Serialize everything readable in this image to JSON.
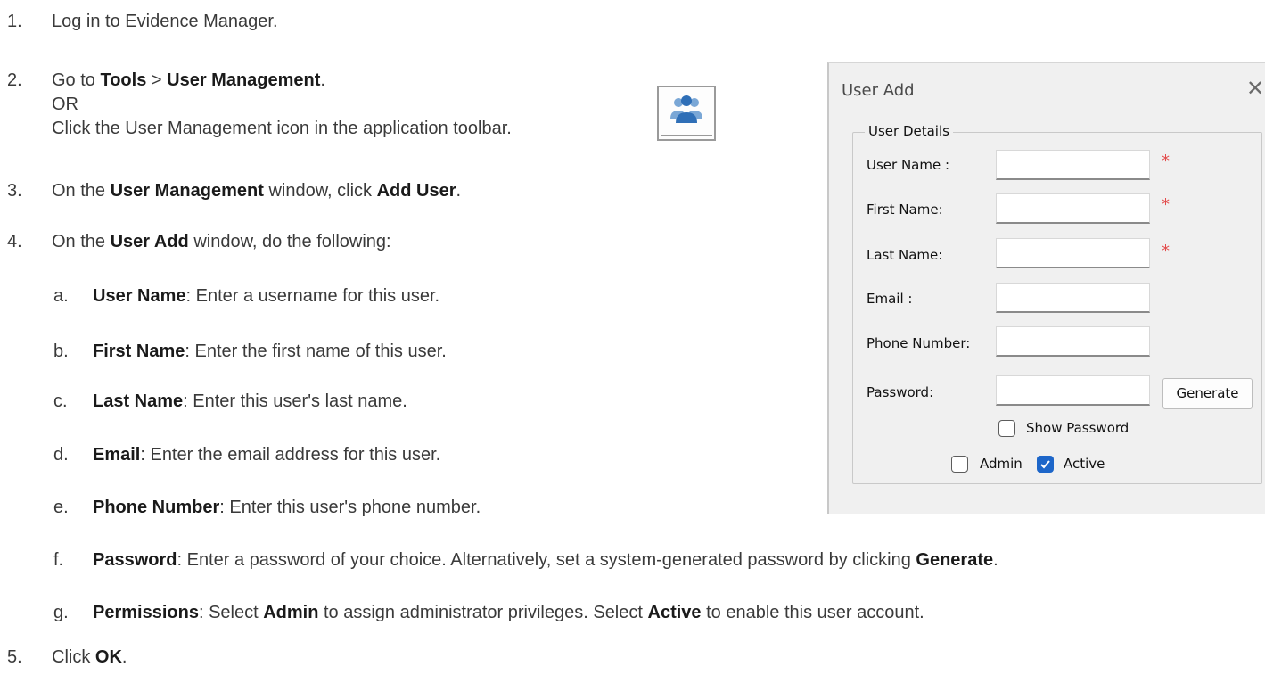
{
  "steps": {
    "s1": {
      "num": "1.",
      "text": "Log in to Evidence Manager."
    },
    "s2": {
      "num": "2.",
      "t1": "Go to ",
      "b1": "Tools",
      "t2": " > ",
      "b2": "User Management",
      "t3": ".",
      "or": "OR",
      "line3": "Click the User Management icon in the application toolbar."
    },
    "s3": {
      "num": "3.",
      "t1": "On the ",
      "b1": "User Management",
      "t2": " window, click ",
      "b2": "Add User",
      "t3": "."
    },
    "s4": {
      "num": "4.",
      "t1": "On the ",
      "b1": "User Add",
      "t2": " window, do the following:"
    },
    "s5": {
      "num": "5.",
      "t1": "Click ",
      "b1": "OK",
      "t2": "."
    }
  },
  "substeps": [
    {
      "letter": "a.",
      "bold": "User Name",
      "text": ": Enter a username for this user."
    },
    {
      "letter": "b.",
      "bold": "First Name",
      "text": ": Enter the first name of this user."
    },
    {
      "letter": "c.",
      "bold": "Last Name",
      "text": ": Enter this user's last name."
    },
    {
      "letter": "d.",
      "bold": "Email",
      "text": ": Enter the email address for this user."
    },
    {
      "letter": "e.",
      "bold": "Phone Number",
      "text": ": Enter this user's phone number."
    },
    {
      "letter": "f.",
      "bold": "Password",
      "text": ": Enter a password of your choice. Alternatively, set a system-generated password by clicking ",
      "bold2": "Generate",
      "text2": "."
    },
    {
      "letter": "g.",
      "bold": "Permissions",
      "text": ": Select ",
      "bold2": "Admin",
      "text2": " to assign administrator privileges. Select ",
      "bold3": "Active",
      "text3": " to enable this user account."
    }
  ],
  "toolbar_icon": {
    "name": "user-management-icon",
    "accent": "#2f6fb7"
  },
  "dialog": {
    "title": "User Add",
    "close": "✕",
    "group_title": "User Details",
    "fields": [
      {
        "label": "User Name :",
        "value": "",
        "required": true
      },
      {
        "label": "First Name:",
        "value": "",
        "required": true
      },
      {
        "label": "Last Name:",
        "value": "",
        "required": true
      },
      {
        "label": "Email :",
        "value": "",
        "required": false
      },
      {
        "label": "Phone Number:",
        "value": "",
        "required": false
      },
      {
        "label": "Password:",
        "value": "",
        "required": false
      }
    ],
    "required_mark": "*",
    "required_color": "#e34b4b",
    "generate_button": "Generate",
    "show_password": {
      "label": "Show Password",
      "checked": false
    },
    "admin": {
      "label": "Admin",
      "checked": false
    },
    "active": {
      "label": "Active",
      "checked": true
    },
    "checkbox_color": "#1d66c9"
  }
}
